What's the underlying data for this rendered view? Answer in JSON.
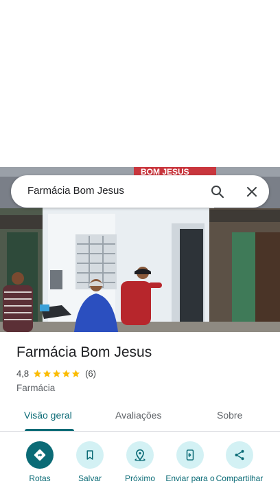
{
  "search": {
    "query": "Farmácia Bom Jesus"
  },
  "photo": {
    "sign_text": "BOM JESUS"
  },
  "place": {
    "name": "Farmácia Bom Jesus",
    "rating": "4,8",
    "stars": 5,
    "review_count": "(6)",
    "category": "Farmácia"
  },
  "tabs": [
    {
      "label": "Visão geral",
      "active": true
    },
    {
      "label": "Avaliações",
      "active": false
    },
    {
      "label": "Sobre",
      "active": false
    }
  ],
  "actions": [
    {
      "label": "Rotas",
      "icon": "directions-icon"
    },
    {
      "label": "Salvar",
      "icon": "bookmark-icon"
    },
    {
      "label": "Próximo",
      "icon": "nearby-icon"
    },
    {
      "label": "Enviar para o",
      "icon": "send-to-phone-icon"
    },
    {
      "label": "Compartilhar",
      "icon": "share-icon"
    }
  ],
  "colors": {
    "accent": "#0b6b76",
    "action_bg": "#d3f1f4",
    "star": "#fbbc04"
  }
}
